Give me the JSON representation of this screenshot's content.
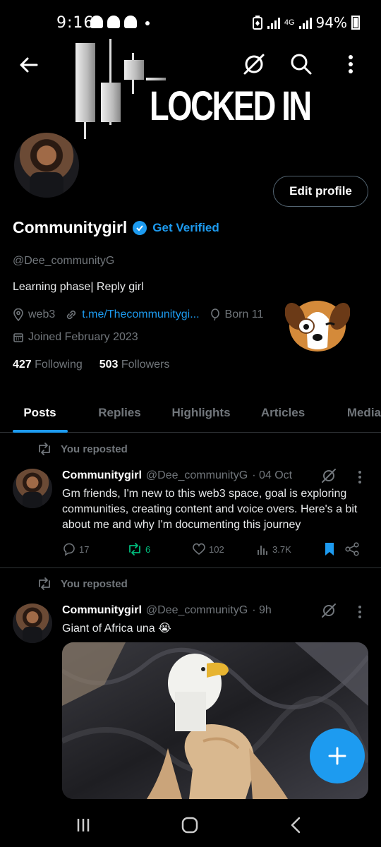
{
  "status_bar": {
    "time": "9:16",
    "network_label": "4G",
    "battery": "94%"
  },
  "banner": {
    "title": "LOCKED IN"
  },
  "profile": {
    "display_name": "Communitygirl",
    "get_verified_label": "Get Verified",
    "handle": "@Dee_communityG",
    "bio": "Learning phase| Reply girl",
    "location": "web3",
    "link": "t.me/Thecommunitygi...",
    "born": "Born 11",
    "joined": "Joined February 2023",
    "following_count": "427",
    "following_label": "Following",
    "followers_count": "503",
    "followers_label": "Followers",
    "edit_button_label": "Edit profile"
  },
  "tabs": [
    {
      "label": "Posts",
      "active": true
    },
    {
      "label": "Replies",
      "active": false
    },
    {
      "label": "Highlights",
      "active": false
    },
    {
      "label": "Articles",
      "active": false
    },
    {
      "label": "Media",
      "active": false
    }
  ],
  "posts": [
    {
      "repost_label": "You reposted",
      "name": "Communitygirl",
      "handle": "@Dee_communityG",
      "time": "· 04 Oct",
      "text": "Gm friends, I'm new to this web3 space, goal is exploring communities, creating content and voice overs. Here's a bit about me and why I'm documenting this journey",
      "replies": "17",
      "reposts": "6",
      "likes": "102",
      "views": "3.7K"
    },
    {
      "repost_label": "You reposted",
      "name": "Communitygirl",
      "handle": "@Dee_communityG",
      "time": "· 9h",
      "text": "Giant of Africa una 😭"
    }
  ],
  "colors": {
    "accent": "#1d9bf0",
    "repost_green": "#00ba7c",
    "muted": "#71767b",
    "background": "#000000"
  }
}
